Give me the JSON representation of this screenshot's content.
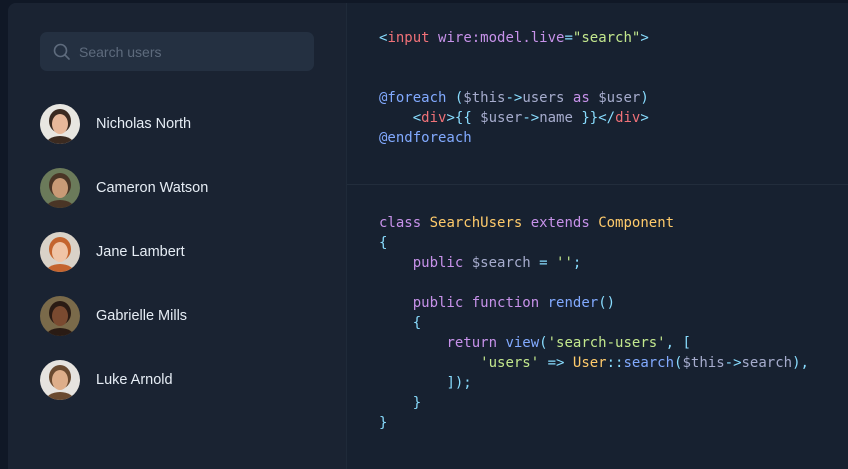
{
  "search": {
    "placeholder": "Search users",
    "value": ""
  },
  "users": [
    {
      "name": "Nicholas North",
      "avatar_bg": "#e8e6e1",
      "skin": "#e8b89a",
      "hair": "#3b2a20"
    },
    {
      "name": "Cameron Watson",
      "avatar_bg": "#6b7a5a",
      "skin": "#c99a76",
      "hair": "#4a3526"
    },
    {
      "name": "Jane Lambert",
      "avatar_bg": "#d9d2c8",
      "skin": "#f0c4a6",
      "hair": "#c4642e"
    },
    {
      "name": "Gabrielle Mills",
      "avatar_bg": "#7a6a4a",
      "skin": "#7a4a30",
      "hair": "#2a1b14"
    },
    {
      "name": "Luke Arnold",
      "avatar_bg": "#e6e3df",
      "skin": "#deae8a",
      "hair": "#6a4a30"
    }
  ],
  "code_top": [
    [
      {
        "t": "<",
        "c": "punct"
      },
      {
        "t": "input",
        "c": "tag"
      },
      {
        "t": " ",
        "c": "plain"
      },
      {
        "t": "wire:model.live",
        "c": "attr"
      },
      {
        "t": "=",
        "c": "punct"
      },
      {
        "t": "\"search\"",
        "c": "str"
      },
      {
        "t": ">",
        "c": "punct"
      }
    ],
    [],
    [],
    [
      {
        "t": "@foreach",
        "c": "fn"
      },
      {
        "t": " (",
        "c": "punct"
      },
      {
        "t": "$this",
        "c": "var"
      },
      {
        "t": "->",
        "c": "punct"
      },
      {
        "t": "users",
        "c": "var"
      },
      {
        "t": " ",
        "c": "plain"
      },
      {
        "t": "as",
        "c": "kw"
      },
      {
        "t": " ",
        "c": "plain"
      },
      {
        "t": "$user",
        "c": "var"
      },
      {
        "t": ")",
        "c": "punct"
      }
    ],
    [
      {
        "t": "    ",
        "c": "plain"
      },
      {
        "t": "<",
        "c": "punct"
      },
      {
        "t": "div",
        "c": "tag"
      },
      {
        "t": ">",
        "c": "punct"
      },
      {
        "t": "{{",
        "c": "punct"
      },
      {
        "t": " $user",
        "c": "var"
      },
      {
        "t": "->",
        "c": "punct"
      },
      {
        "t": "name",
        "c": "var"
      },
      {
        "t": " }}",
        "c": "punct"
      },
      {
        "t": "</",
        "c": "punct"
      },
      {
        "t": "div",
        "c": "tag"
      },
      {
        "t": ">",
        "c": "punct"
      }
    ],
    [
      {
        "t": "@endforeach",
        "c": "fn"
      }
    ]
  ],
  "code_bottom": [
    [
      {
        "t": "class",
        "c": "kw"
      },
      {
        "t": " ",
        "c": "plain"
      },
      {
        "t": "SearchUsers",
        "c": "cls"
      },
      {
        "t": " ",
        "c": "plain"
      },
      {
        "t": "extends",
        "c": "kw"
      },
      {
        "t": " ",
        "c": "plain"
      },
      {
        "t": "Component",
        "c": "cls"
      }
    ],
    [
      {
        "t": "{",
        "c": "punct"
      }
    ],
    [
      {
        "t": "    ",
        "c": "plain"
      },
      {
        "t": "public",
        "c": "kw"
      },
      {
        "t": " ",
        "c": "plain"
      },
      {
        "t": "$search",
        "c": "var"
      },
      {
        "t": " = ",
        "c": "punct"
      },
      {
        "t": "''",
        "c": "str"
      },
      {
        "t": ";",
        "c": "punct"
      }
    ],
    [],
    [
      {
        "t": "    ",
        "c": "plain"
      },
      {
        "t": "public",
        "c": "kw"
      },
      {
        "t": " ",
        "c": "plain"
      },
      {
        "t": "function",
        "c": "kw"
      },
      {
        "t": " ",
        "c": "plain"
      },
      {
        "t": "render",
        "c": "fn"
      },
      {
        "t": "()",
        "c": "punct"
      }
    ],
    [
      {
        "t": "    ",
        "c": "plain"
      },
      {
        "t": "{",
        "c": "punct"
      }
    ],
    [
      {
        "t": "        ",
        "c": "plain"
      },
      {
        "t": "return",
        "c": "kw"
      },
      {
        "t": " ",
        "c": "plain"
      },
      {
        "t": "view",
        "c": "fn"
      },
      {
        "t": "(",
        "c": "punct"
      },
      {
        "t": "'search-users'",
        "c": "str"
      },
      {
        "t": ", [",
        "c": "punct"
      }
    ],
    [
      {
        "t": "            ",
        "c": "plain"
      },
      {
        "t": "'users'",
        "c": "str"
      },
      {
        "t": " => ",
        "c": "punct"
      },
      {
        "t": "User",
        "c": "cls"
      },
      {
        "t": "::",
        "c": "punct"
      },
      {
        "t": "search",
        "c": "fn"
      },
      {
        "t": "(",
        "c": "punct"
      },
      {
        "t": "$this",
        "c": "var"
      },
      {
        "t": "->",
        "c": "punct"
      },
      {
        "t": "search",
        "c": "var"
      },
      {
        "t": "),",
        "c": "punct"
      }
    ],
    [
      {
        "t": "        ",
        "c": "plain"
      },
      {
        "t": "]);",
        "c": "punct"
      }
    ],
    [
      {
        "t": "    ",
        "c": "plain"
      },
      {
        "t": "}",
        "c": "punct"
      }
    ],
    [
      {
        "t": "}",
        "c": "punct"
      }
    ]
  ]
}
